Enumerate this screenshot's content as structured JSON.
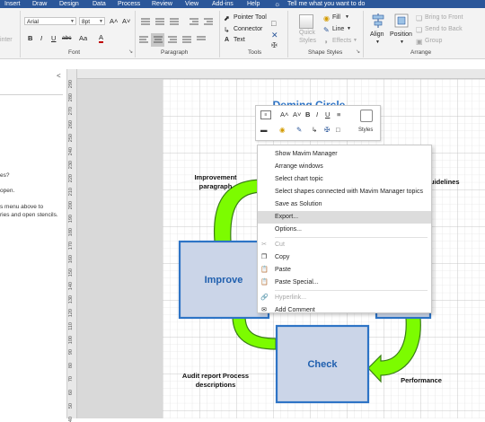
{
  "tabs": [
    "Insert",
    "Draw",
    "Design",
    "Data",
    "Process",
    "Review",
    "View",
    "Add-ins",
    "Help"
  ],
  "tell_me": "Tell me what you want to do",
  "ribbon": {
    "left_cut": "inter",
    "font_name": "Arial",
    "font_size": "8pt",
    "grow": "A˄",
    "shrink": "A˅",
    "bold": "B",
    "italic": "I",
    "underline": "U",
    "strike": "abc",
    "case": "Aa",
    "color": "A",
    "pointer_tool": "Pointer Tool",
    "connector": "Connector",
    "text": "Text",
    "fill": "Fill",
    "line": "Line",
    "effects": "Effects",
    "quick_styles_1": "Quick",
    "quick_styles_2": "Styles",
    "align": "Align",
    "position": "Position",
    "bring_front": "Bring to Front",
    "send_back": "Send to Back",
    "group": "Group",
    "groups": [
      "Font",
      "Paragraph",
      "Tools",
      "Shape Styles",
      "Arrange"
    ]
  },
  "left_panel": {
    "chevron": "<",
    "lines": [
      "es?",
      "open.",
      "s menu above to",
      "ries and open stencils."
    ]
  },
  "ruler_marks": [
    "290",
    "280",
    "270",
    "260",
    "250",
    "240",
    "230",
    "220",
    "210",
    "200",
    "190",
    "180",
    "170",
    "160",
    "150",
    "140",
    "130",
    "120",
    "110",
    "100",
    "90",
    "80",
    "70",
    "60",
    "50",
    "40"
  ],
  "diagram": {
    "title": "Deming Circle",
    "improve": "Improve",
    "check": "Check",
    "plan_partial": "n",
    "improvement_paragraph_1": "Improvement",
    "improvement_paragraph_2": "paragraph",
    "guidelines_partial": "uidelines",
    "audit_1": "Audit report Process",
    "audit_2": "descriptions",
    "performance": "Performance"
  },
  "mini_toolbar": {
    "grow": "A˄",
    "shrink": "A˅",
    "bold": "B",
    "italic": "I",
    "underline": "U",
    "styles": "Styles"
  },
  "context_menu": [
    {
      "label": "Show Mavim Manager",
      "icon": "",
      "disabled": false,
      "highlighted": false
    },
    {
      "label": "Arrange windows",
      "icon": "",
      "disabled": false,
      "highlighted": false
    },
    {
      "label": "Select chart topic",
      "icon": "",
      "disabled": false,
      "highlighted": false
    },
    {
      "label": "Select shapes connected with Mavim Manager topics",
      "icon": "",
      "disabled": false,
      "highlighted": false
    },
    {
      "label": "Save as Solution",
      "icon": "",
      "disabled": false,
      "highlighted": false
    },
    {
      "label": "Export...",
      "icon": "",
      "disabled": false,
      "highlighted": true
    },
    {
      "label": "Options...",
      "icon": "",
      "disabled": false,
      "highlighted": false
    },
    {
      "label": "Cut",
      "icon": "cut-icon",
      "disabled": true,
      "highlighted": false
    },
    {
      "label": "Copy",
      "icon": "copy-icon",
      "disabled": false,
      "highlighted": false
    },
    {
      "label": "Paste",
      "icon": "paste-icon",
      "disabled": false,
      "highlighted": false
    },
    {
      "label": "Paste Special...",
      "icon": "paste-special-icon",
      "disabled": false,
      "highlighted": false
    },
    {
      "label": "Hyperlink...",
      "icon": "hyperlink-icon",
      "disabled": true,
      "highlighted": false
    },
    {
      "label": "Add Comment",
      "icon": "comment-icon",
      "disabled": false,
      "highlighted": false
    }
  ],
  "colors": {
    "title_bar": "#2b579a",
    "arrow_green": "#7cfc00",
    "box_fill": "#cbd5e8",
    "box_border": "#2e74c6",
    "box_text": "#1f5fae"
  }
}
